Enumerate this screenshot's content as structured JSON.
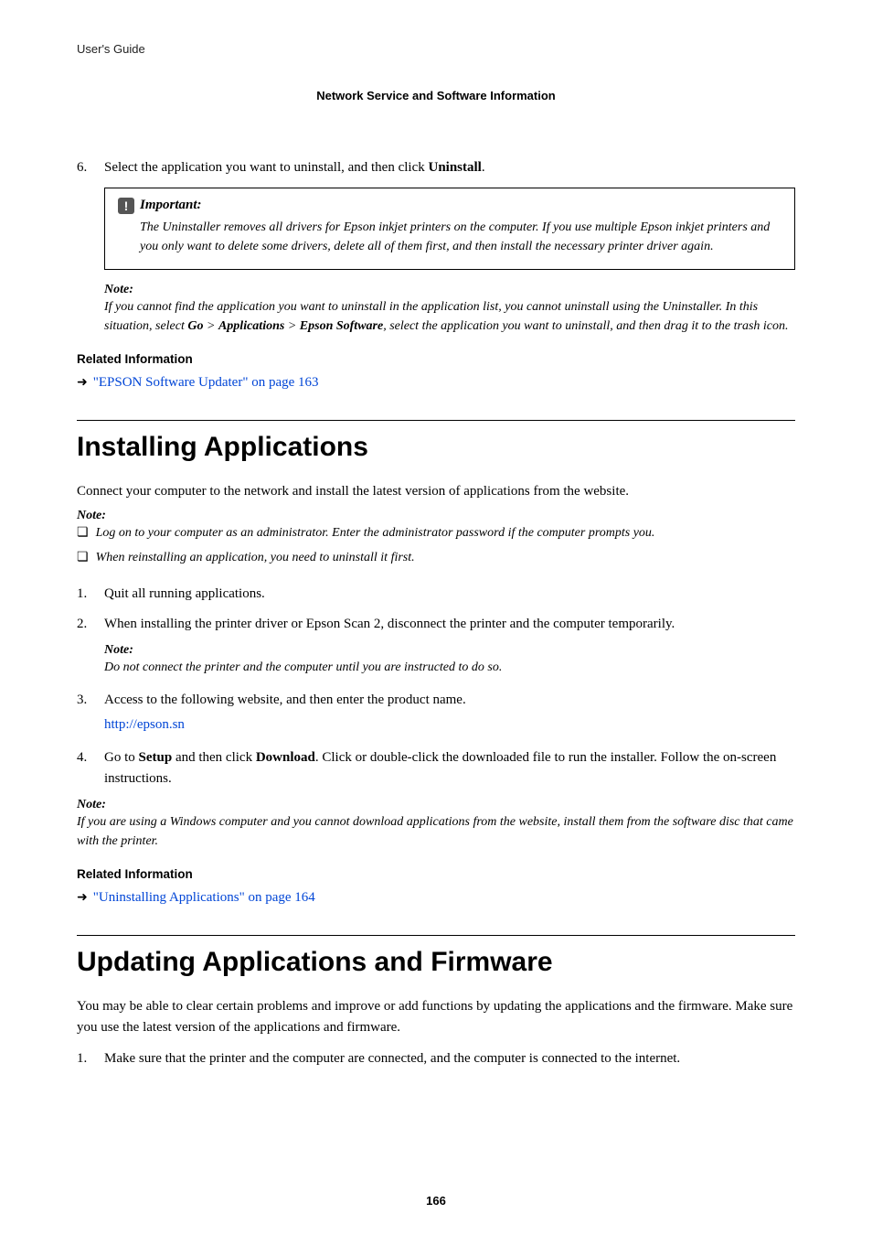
{
  "header": {
    "guide": "User's Guide",
    "section": "Network Service and Software Information"
  },
  "step6": {
    "num": "6.",
    "text_before": "Select the application you want to uninstall, and then click ",
    "bold": "Uninstall",
    "text_after": "."
  },
  "important": {
    "label": "Important:",
    "text": "The Uninstaller removes all drivers for Epson inkjet printers on the computer. If you use multiple Epson inkjet printers and you only want to delete some drivers, delete all of them first, and then install the necessary printer driver again."
  },
  "note1": {
    "label": "Note:",
    "pre": "If you cannot find the application you want to uninstall in the application list, you cannot uninstall using the Uninstaller. In this situation, select ",
    "b1": "Go",
    "gt1": " > ",
    "b2": "Applications",
    "gt2": " > ",
    "b3": "Epson Software",
    "post": ", select the application you want to uninstall, and then drag it to the trash icon."
  },
  "related1": {
    "heading": "Related Information",
    "link": "\"EPSON Software Updater\" on page 163"
  },
  "h1a": "Installing Applications",
  "intro_a": "Connect your computer to the network and install the latest version of applications from the website.",
  "note2": {
    "label": "Note:",
    "item1": "Log on to your computer as an administrator. Enter the administrator password if the computer prompts you.",
    "item2": "When reinstalling an application, you need to uninstall it first."
  },
  "steps_a": {
    "s1": {
      "num": "1.",
      "text": "Quit all running applications."
    },
    "s2": {
      "num": "2.",
      "text": "When installing the printer driver or Epson Scan 2, disconnect the printer and the computer temporarily."
    },
    "s2note": {
      "label": "Note:",
      "text": "Do not connect the printer and the computer until you are instructed to do so."
    },
    "s3": {
      "num": "3.",
      "text": "Access to the following website, and then enter the product name.",
      "link": "http://epson.sn"
    },
    "s4": {
      "num": "4.",
      "pre": "Go to ",
      "b1": "Setup",
      "mid": " and then click ",
      "b2": "Download",
      "post": ". Click or double-click the downloaded file to run the installer. Follow the on-screen instructions."
    }
  },
  "note3": {
    "label": "Note:",
    "text": "If you are using a Windows computer and you cannot download applications from the website, install them from the software disc that came with the printer."
  },
  "related2": {
    "heading": "Related Information",
    "link": "\"Uninstalling Applications\" on page 164"
  },
  "h1b": "Updating Applications and Firmware",
  "intro_b": "You may be able to clear certain problems and improve or add functions by updating the applications and the firmware. Make sure you use the latest version of the applications and firmware.",
  "steps_b": {
    "s1": {
      "num": "1.",
      "text": "Make sure that the printer and the computer are connected, and the computer is connected to the internet."
    }
  },
  "page_num": "166"
}
